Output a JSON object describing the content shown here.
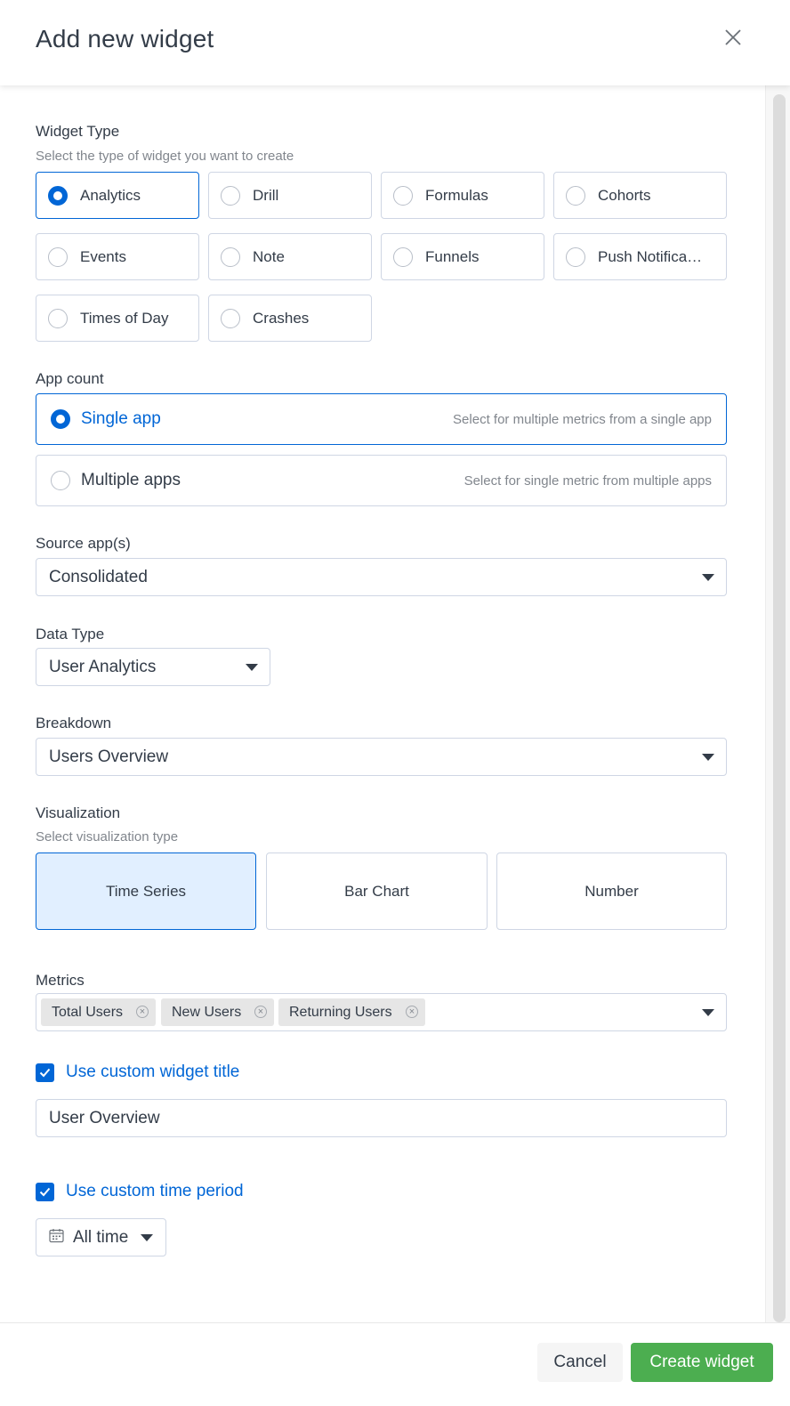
{
  "dialog": {
    "title": "Add new widget"
  },
  "widget_type": {
    "label": "Widget Type",
    "subtitle": "Select the type of widget you want to create",
    "options": [
      {
        "label": "Analytics",
        "selected": true
      },
      {
        "label": "Drill",
        "selected": false
      },
      {
        "label": "Formulas",
        "selected": false
      },
      {
        "label": "Cohorts",
        "selected": false
      },
      {
        "label": "Events",
        "selected": false
      },
      {
        "label": "Note",
        "selected": false
      },
      {
        "label": "Funnels",
        "selected": false
      },
      {
        "label": "Push Notifica…",
        "selected": false
      },
      {
        "label": "Times of Day",
        "selected": false
      },
      {
        "label": "Crashes",
        "selected": false
      }
    ]
  },
  "app_count": {
    "label": "App count",
    "options": [
      {
        "label": "Single app",
        "desc": "Select for multiple metrics from a single app",
        "selected": true
      },
      {
        "label": "Multiple apps",
        "desc": "Select for single metric from multiple apps",
        "selected": false
      }
    ]
  },
  "source_apps": {
    "label": "Source app(s)",
    "value": "Consolidated"
  },
  "data_type": {
    "label": "Data Type",
    "value": "User Analytics"
  },
  "breakdown": {
    "label": "Breakdown",
    "value": "Users Overview"
  },
  "visualization": {
    "label": "Visualization",
    "subtitle": "Select visualization type",
    "options": [
      {
        "label": "Time Series",
        "selected": true
      },
      {
        "label": "Bar Chart",
        "selected": false
      },
      {
        "label": "Number",
        "selected": false
      }
    ]
  },
  "metrics": {
    "label": "Metrics",
    "chips": [
      "Total Users",
      "New Users",
      "Returning Users"
    ]
  },
  "custom_title": {
    "label": "Use custom widget title",
    "checked": true,
    "value": "User Overview"
  },
  "custom_period": {
    "label": "Use custom time period",
    "checked": true,
    "value": "All time"
  },
  "footer": {
    "cancel": "Cancel",
    "create": "Create widget"
  },
  "colors": {
    "accent": "#0166d6",
    "create_button": "#4cae50",
    "selected_viz_bg": "#e1efff"
  },
  "icons": {
    "close": "close-icon",
    "calendar": "calendar-icon",
    "dropdown": "chevron-down-icon",
    "remove_chip": "remove-icon",
    "check": "check-icon"
  }
}
